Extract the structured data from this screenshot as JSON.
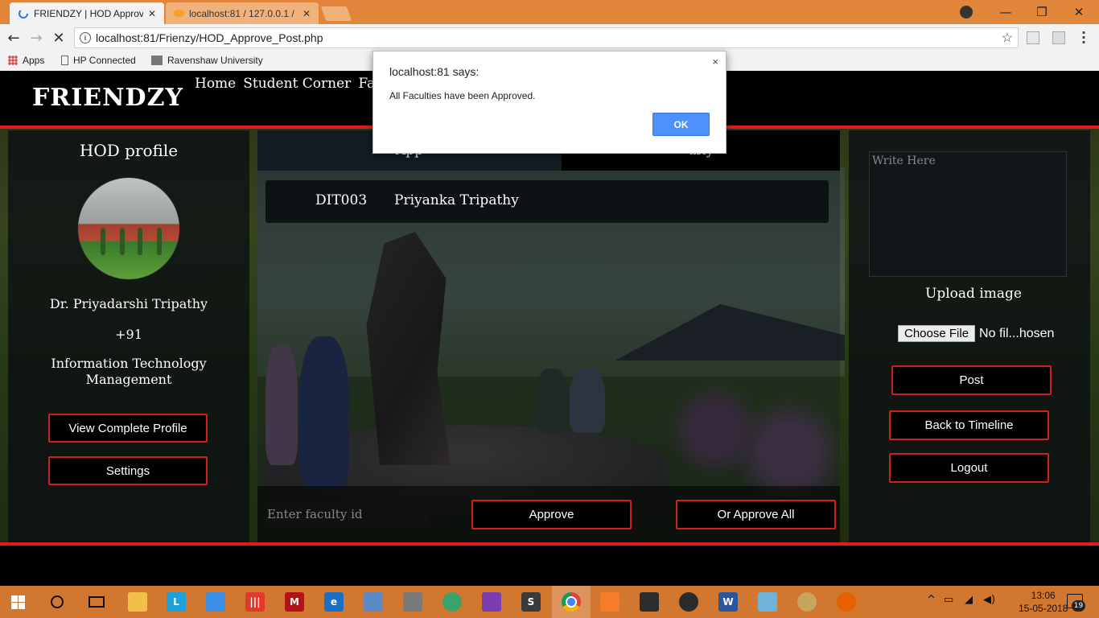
{
  "browser": {
    "tabs": [
      {
        "title": "FRIENDZY | HOD Approv",
        "close": "✕"
      },
      {
        "title": "localhost:81 / 127.0.0.1 /",
        "close": "✕"
      }
    ],
    "url": "localhost:81/Frienzy/HOD_Approve_Post.php",
    "bookmarks": [
      "Apps",
      "HP Connected",
      "Ravenshaw University"
    ]
  },
  "site": {
    "brand": "FRIENDZY",
    "nav": [
      "Home",
      "Student Corner",
      "Fa"
    ]
  },
  "left": {
    "title": "HOD profile",
    "name": "Dr. Priyadarshi Tripathy",
    "phone": "+91",
    "department": "Information Technology Management",
    "view_profile": "View Complete Profile",
    "settings": "Settings"
  },
  "center": {
    "tab1": "App",
    "tab2": "ulty",
    "faculty": {
      "id": "DIT003",
      "name": "Priyanka Tripathy"
    },
    "input_placeholder": "Enter faculty id",
    "approve": "Approve",
    "approve_all": "Or Approve All"
  },
  "right": {
    "write_placeholder": "Write Here",
    "upload_label": "Upload image",
    "choose_file": "Choose File",
    "no_file": "No fil...hosen",
    "post": "Post",
    "back": "Back to Timeline",
    "logout": "Logout"
  },
  "alert": {
    "title": "localhost:81 says:",
    "message": "All Faculties have been Approved.",
    "ok": "OK",
    "close": "×"
  },
  "taskbar": {
    "time": "13:06",
    "date": "15-05-2018",
    "notifications": "19"
  },
  "colors": {
    "accent": "#e21c1c",
    "taskbar": "#d2772f",
    "tabbar": "#e0853a",
    "ok_button": "#4d90fe"
  }
}
